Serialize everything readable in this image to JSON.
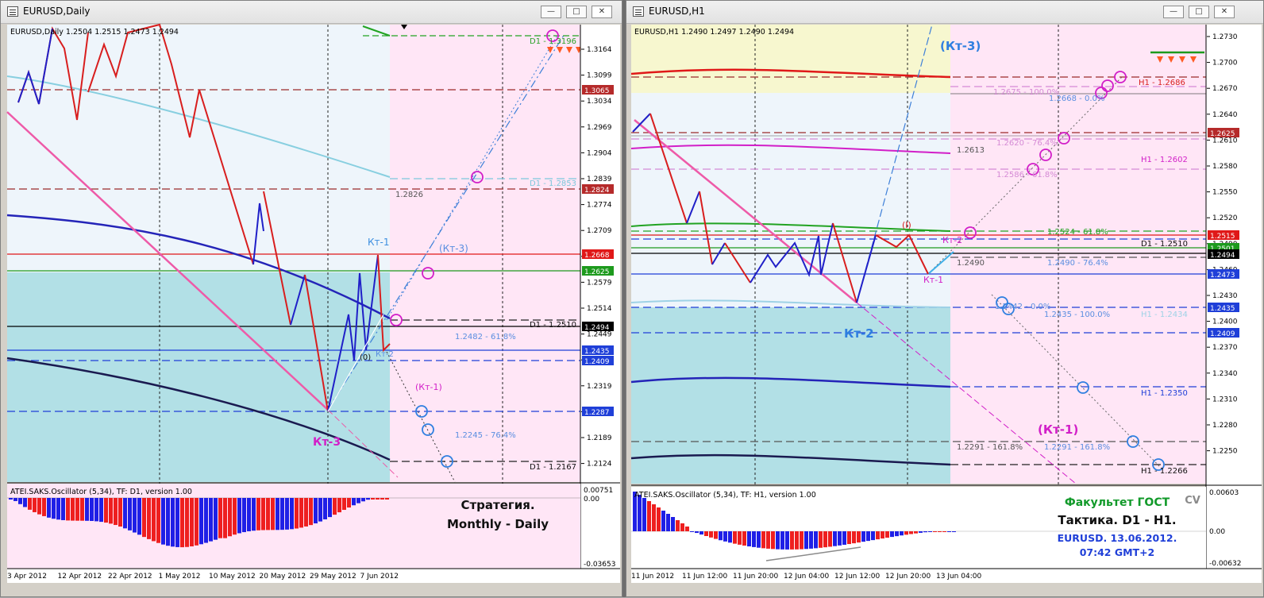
{
  "left_window": {
    "title": "EURUSD,Daily",
    "header": "EURUSD,Daily  1.2504 1.2515 1.2473 1.2494",
    "price_ticks": [
      "1.3164",
      "1.3099",
      "1.3034",
      "1.2969",
      "1.2904",
      "1.2839",
      "1.2774",
      "1.2709",
      "1.2644",
      "1.2579",
      "1.2514",
      "1.2449",
      "1.2384",
      "1.2319",
      "1.2254",
      "1.2189",
      "1.2124"
    ],
    "price_tags": [
      {
        "text": "1.3065",
        "color": "#b52a2a"
      },
      {
        "text": "1.2824",
        "color": "#b52a2a"
      },
      {
        "text": "1.2668",
        "color": "#e01818"
      },
      {
        "text": "1.2625",
        "color": "#1d9a1d"
      },
      {
        "text": "1.2494",
        "color": "#000000"
      },
      {
        "text": "1.2435",
        "color": "#1f3fd8"
      },
      {
        "text": "1.2409",
        "color": "#1f3fd8"
      },
      {
        "text": "1.2287",
        "color": "#1f3fd8"
      }
    ],
    "level_labels": [
      "D1 - 1.3196",
      "D1 - 1.2853",
      "1.2826",
      "D1 - 1.2510",
      "1.2482 - 61.8%",
      "1.2245 - 76.4%",
      "D1 - 1.2167"
    ],
    "wave_labels": [
      "Кт-1",
      "(Кт-3)",
      "Кт-2",
      "(0)",
      "(Кт-1)",
      "Кт-3"
    ],
    "osc_header": "ATEI.SAKS.Oscillator (5,34), TF: D1, version 1.00",
    "osc_ticks": [
      "0.00751",
      "0.00",
      "-0.03653"
    ],
    "dates": [
      "3 Apr 2012",
      "12 Apr 2012",
      "22 Apr 2012",
      "1 May 2012",
      "10 May 2012",
      "20 May 2012",
      "29 May 2012",
      "7 Jun 2012"
    ],
    "strategy_line1": "Стратегия.",
    "strategy_line2": "Monthly - Daily"
  },
  "right_window": {
    "title": "EURUSD,H1",
    "header": "EURUSD,H1  1.2490 1.2497 1.2490 1.2494",
    "price_ticks": [
      "1.2730",
      "1.2700",
      "1.2670",
      "1.2640",
      "1.2610",
      "1.2580",
      "1.2550",
      "1.2520",
      "1.2490",
      "1.2460",
      "1.2430",
      "1.2400",
      "1.2370",
      "1.2340",
      "1.2310",
      "1.2280",
      "1.2250"
    ],
    "price_tags": [
      {
        "text": "1.2625",
        "color": "#b52a2a"
      },
      {
        "text": "1.2515",
        "color": "#e01818"
      },
      {
        "text": "1.2501",
        "color": "#1d9a1d"
      },
      {
        "text": "1.2494",
        "color": "#000000"
      },
      {
        "text": "1.2473",
        "color": "#1f3fd8"
      },
      {
        "text": "1.2435",
        "color": "#1f3fd8"
      },
      {
        "text": "1.2409",
        "color": "#1f3fd8"
      }
    ],
    "level_labels": [
      "H1 - 1.2686",
      "1.2675 - 100.0%",
      "1.2668 - 0.0%",
      "1.2613",
      "1.2620 - 76.4%",
      "H1 - 1.2602",
      "1.2586 - 61.8%",
      "1.2524 - 61.8%",
      "D1 - 1.2510",
      "1.2490",
      "1.2490 - 76.4%",
      "1.2442 - 0.0%",
      "1.2435 - 100.0%",
      "H1 - 1.2434",
      "H1 - 1.2350",
      "1.2291 - 161.8%",
      "1.2291 - 161.8%",
      "H1 - 1.2266"
    ],
    "wave_labels": [
      "(Кт-3)",
      "(I)",
      "Кт-2",
      "Кт-1",
      "Кт-2",
      "(Кт-1)"
    ],
    "osc_header": "ATEI.SAKS.Oscillator (5,34), TF: H1, version 1.00",
    "osc_ticks": [
      "0.00603",
      "0.00",
      "-0.00632"
    ],
    "dates": [
      "11 Jun 2012",
      "11 Jun 12:00",
      "11 Jun 20:00",
      "12 Jun 04:00",
      "12 Jun 12:00",
      "12 Jun 20:00",
      "13 Jun 04:00"
    ],
    "info_line1": "Факультет ГОСТ",
    "info_cv": "CV",
    "info_line2": "Тактика. D1 - H1.",
    "info_line3": "EURUSD. 13.06.2012.",
    "info_line4": "07:42  GMT+2"
  },
  "colors": {
    "pink_zone": "#ffe6f6",
    "teal_zone": "#b2e0e6",
    "yellow_zone": "#f7f7cf",
    "osc_blue": "#1f1fe6",
    "osc_red": "#ee1f1f"
  },
  "chart_data": [
    {
      "type": "line",
      "title": "EURUSD,Daily",
      "ylim": [
        1.2124,
        1.3229
      ],
      "x_ticks": [
        "3 Apr 2012",
        "12 Apr 2012",
        "22 Apr 2012",
        "1 May 2012",
        "10 May 2012",
        "20 May 2012",
        "29 May 2012",
        "7 Jun 2012"
      ],
      "last_close": 1.2494,
      "levels": [
        1.3196,
        1.3065,
        1.2853,
        1.2824,
        1.2668,
        1.2625,
        1.251,
        1.2494,
        1.2482,
        1.2435,
        1.2409,
        1.2287,
        1.2245,
        1.2167
      ],
      "oscillator_range": [
        -0.03653,
        0.00751
      ]
    },
    {
      "type": "line",
      "title": "EURUSD,H1",
      "ylim": [
        1.225,
        1.273
      ],
      "x_ticks": [
        "11 Jun 2012",
        "11 Jun 12:00",
        "11 Jun 20:00",
        "12 Jun 04:00",
        "12 Jun 12:00",
        "12 Jun 20:00",
        "13 Jun 04:00"
      ],
      "last_close": 1.2494,
      "levels": [
        1.2686,
        1.2675,
        1.2668,
        1.2625,
        1.262,
        1.2613,
        1.2602,
        1.2586,
        1.2524,
        1.2515,
        1.251,
        1.2501,
        1.2494,
        1.249,
        1.2473,
        1.2442,
        1.2435,
        1.2434,
        1.2409,
        1.235,
        1.2291,
        1.2266
      ],
      "oscillator_range": [
        -0.00632,
        0.00603
      ]
    }
  ]
}
